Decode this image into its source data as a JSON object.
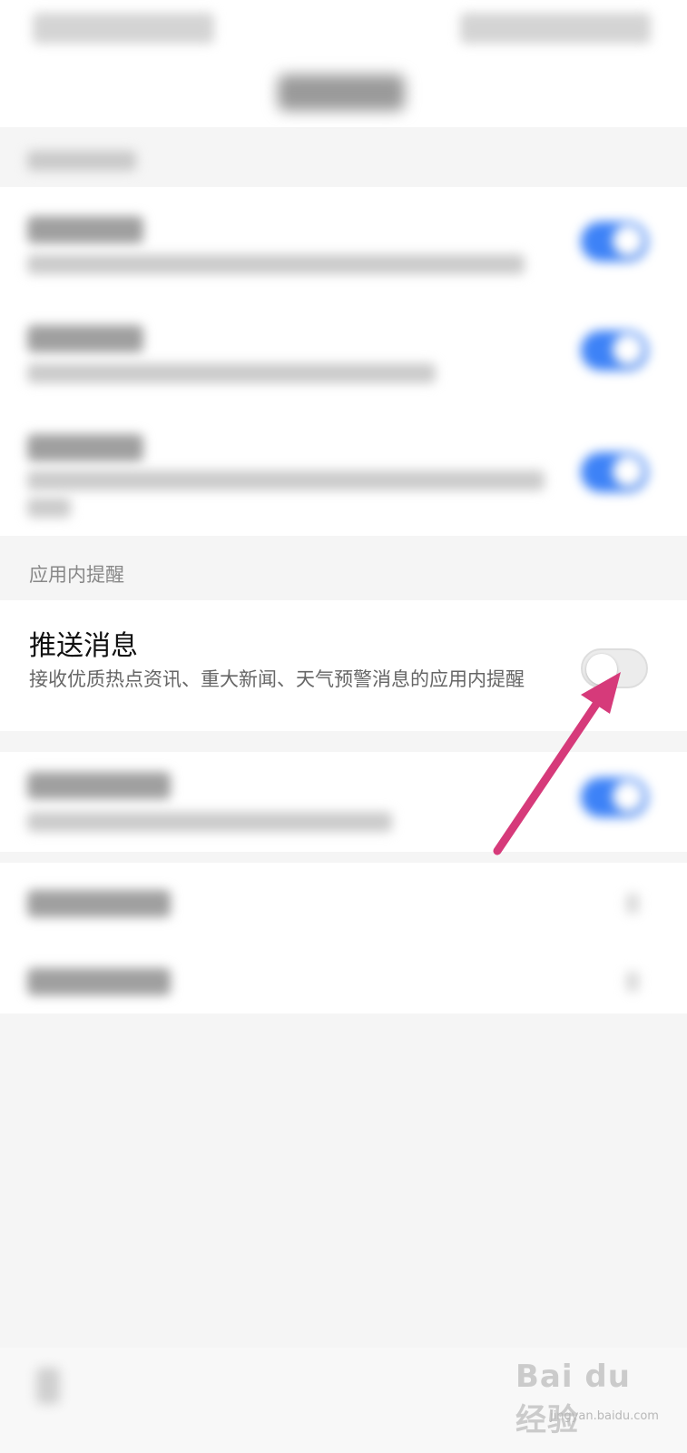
{
  "in_app_section": {
    "label": "应用内提醒"
  },
  "push_row": {
    "title": "推送消息",
    "description": "接收优质热点资讯、重大新闻、天气预警消息的应用内提醒",
    "toggle_on": false
  },
  "watermark": {
    "brand": "Bai du 经验",
    "url": "jingyan.baidu.com"
  },
  "colors": {
    "toggle_on": "#3d82f7",
    "arrow": "#d63a7a"
  }
}
